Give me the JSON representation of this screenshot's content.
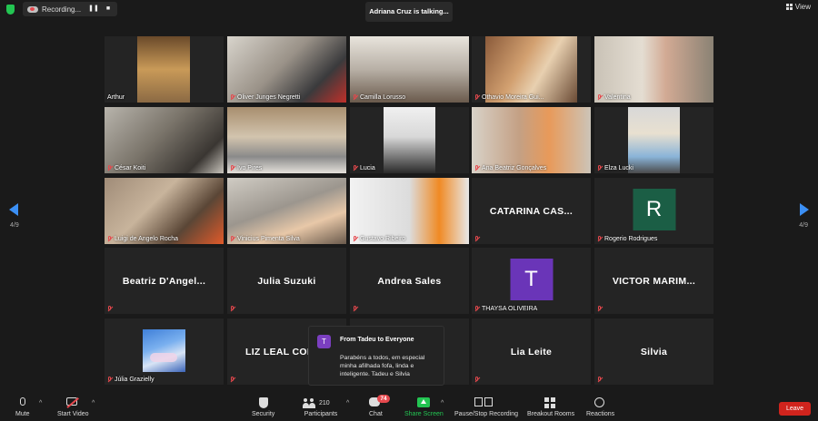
{
  "topbar": {
    "recording_label": "Recording...",
    "talking_text": "Adriana Cruz is talking...",
    "view_label": "View"
  },
  "pager": {
    "left": "4/9",
    "right": "4/9"
  },
  "tiles": [
    {
      "name": "Arthur",
      "muted": false
    },
    {
      "name": "Oliver Junges Negretti",
      "muted": true
    },
    {
      "name": "Camilla Lorusso",
      "muted": true
    },
    {
      "name": "Othavio Moreira Gui...",
      "muted": true
    },
    {
      "name": "Valentina",
      "muted": true
    },
    {
      "name": "César Koiti",
      "muted": true
    },
    {
      "name": "Ivo Pires",
      "muted": true
    },
    {
      "name": "Lucia",
      "muted": true
    },
    {
      "name": "Ana Beatriz Gonçalves",
      "muted": true
    },
    {
      "name": "Elza Lucki",
      "muted": true
    },
    {
      "name": "Luigi de Angelo Rocha",
      "muted": true
    },
    {
      "name": "Vinicius Pimenta Silva",
      "muted": true
    },
    {
      "name": "Gustavo Ribeiro",
      "muted": true
    },
    {
      "big": "CATARINA CAS...",
      "muted": true
    },
    {
      "name": "Rogerio Rodrigues",
      "avatar": "R",
      "avatar_color": "#1b5e45",
      "muted": true
    },
    {
      "big": "Beatriz D'Angel...",
      "muted": true
    },
    {
      "big": "Julia Suzuki",
      "muted": true
    },
    {
      "big": "Andrea Sales",
      "muted": true
    },
    {
      "name": "THAYSA OLIVEIRA",
      "avatar": "T",
      "avatar_color": "#6a35b8",
      "muted": true
    },
    {
      "big": "VICTOR MARIM...",
      "muted": true
    },
    {
      "name": "Júlia Grazielly",
      "muted": true
    },
    {
      "big": "LIZ LEAL COE",
      "muted": true
    },
    {
      "big": "",
      "muted": true
    },
    {
      "big": "Lia Leite",
      "muted": true
    },
    {
      "big": "Silvia",
      "muted": true
    }
  ],
  "chat_popup": {
    "avatar": "T",
    "from": "From Tadeu to Everyone",
    "message": "Parabéns a todos, em especial minha afilhada fofa, linda e inteligente. Tadeu e Silvia"
  },
  "toolbar": {
    "mute": "Mute",
    "start_video": "Start Video",
    "security": "Security",
    "participants": "Participants",
    "participants_count": "210",
    "chat": "Chat",
    "chat_badge": "74",
    "share_screen": "Share Screen",
    "pause_recording": "Pause/Stop Recording",
    "breakout_rooms": "Breakout Rooms",
    "reactions": "Reactions",
    "leave": "Leave"
  },
  "colors": {
    "accent_blue": "#3b8ff4",
    "share_green": "#23c552",
    "leave_red": "#d0241d"
  }
}
